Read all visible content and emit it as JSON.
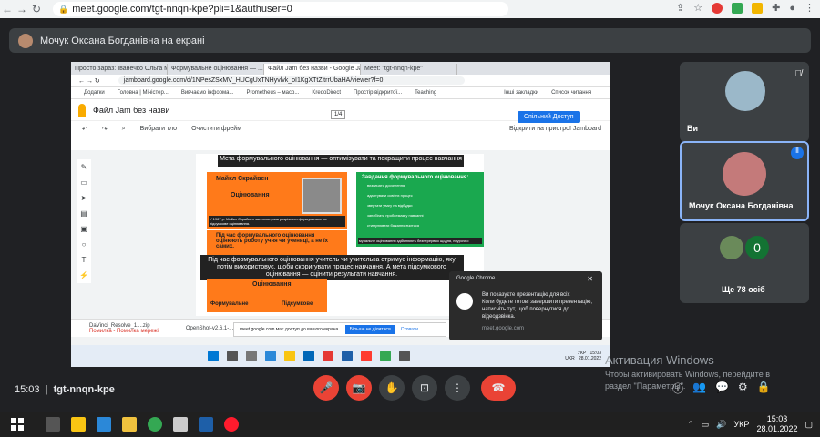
{
  "browser": {
    "url": "meet.google.com/tgt-nnqn-kpe?pli=1&authuser=0"
  },
  "presenter_bar": {
    "label": "Мочук Оксана Богданівна на екрані"
  },
  "shared_screen": {
    "tabs": [
      "Просто зараз: Іванечко Ольга М.",
      "Формувальне оцінювання — ...",
      "Файл Jam без назви - Google Ja...",
      "Meet: \"tgt-nnqn-kpe\""
    ],
    "address": "jamboard.google.com/d/1NPesZSxMV_HUCgUxTNHyvlvk_oI1KgXTtZltrrUbaHA/viewer?f=0",
    "bookmarks": [
      "Додатки",
      "Головна | Міністер...",
      "Вивчаємо інформа...",
      "Prometheus – масо...",
      "KredoDirect",
      "Простір відкритої...",
      "Teaching",
      "Інші закладки",
      "Список читання"
    ],
    "jam_title": "Файл Jam без назви",
    "frame": "1/4",
    "share_btn": "Спільний Доступ",
    "tool_zoom": "Вибрати тло",
    "tool_clear": "Очистити фрейм",
    "open_device": "Відкрити на пристрої Jamboard",
    "slide": {
      "title": "Мета формувального оцінювання — оптимізувати та покращити процес навчання",
      "name": "Майкл Скрайвен",
      "orange_title": "Оцінювання",
      "photo_caption": "У 1967 р. Майкл Скрайвен запропонував розрізняти формувальне та підсумкове оцінювання.",
      "green_title": "Завдання формувального оцінювання:",
      "green_items": [
        "визначати досягнення",
        "адаптувати освітнє процес",
        "звертати увагу на відбудки",
        "запобігати проблемам у навчанні",
        "стимулювати бажання вчитися"
      ],
      "green_caption": "мувальне оцінювання здійснюють безперервно щодня, поурочно",
      "orange2": "Під час формувального оцінювання оцінюють роботу учня чи учениці, а не їх самих.",
      "black_text": "Під час формувального оцінювання учитель чи учителька отримує інформацію, яку потім використовує, щоби скоригувати процес навчання. А мета підсумкового оцінювання — оцінити результати навчання.",
      "bottom_title": "Оцінювання",
      "bottom_left": "Формувальне",
      "bottom_right": "Підсумкове"
    },
    "downloads": [
      "DaVinci_Resolve_1....zip",
      "Помилка - Помилка мережі",
      "OpenShot-v2.6.1-..."
    ],
    "share_strip": {
      "text": "meet.google.com має доступ до вашого екрана.",
      "stop": "Більше не ділитися",
      "hide": "Сховати"
    },
    "taskbar_tray": {
      "lang": "УКР",
      "lang2": "UKR",
      "time": "15:03",
      "date": "28.01.2022"
    }
  },
  "toast": {
    "app": "Google Chrome",
    "title": "Ви показуєте презентацію для всіх",
    "body": "Коли будете готові завершити презентацію, натисніть тут, щоб повернутися до відеодзвінка.",
    "source": "meet.google.com"
  },
  "tiles": [
    {
      "name": "Ви"
    },
    {
      "name": "Мочук Оксана Богданівна"
    },
    {
      "name": "Ще 78 осіб",
      "count": "0"
    }
  ],
  "watermark": {
    "line1": "Активация Windows",
    "line2": "Чтобы активировать Windows, перейдите в",
    "line3": "раздел \"Параметры\"."
  },
  "meet_bar": {
    "time": "15:03",
    "code": "tgt-nnqn-kpe"
  },
  "win_taskbar": {
    "lang": "УКР",
    "time": "15:03",
    "date": "28.01.2022"
  },
  "colors": {
    "end_call": "#ea4335",
    "accent": "#1a73e8",
    "orange": "#ff7a1a",
    "green": "#1aa84f"
  }
}
